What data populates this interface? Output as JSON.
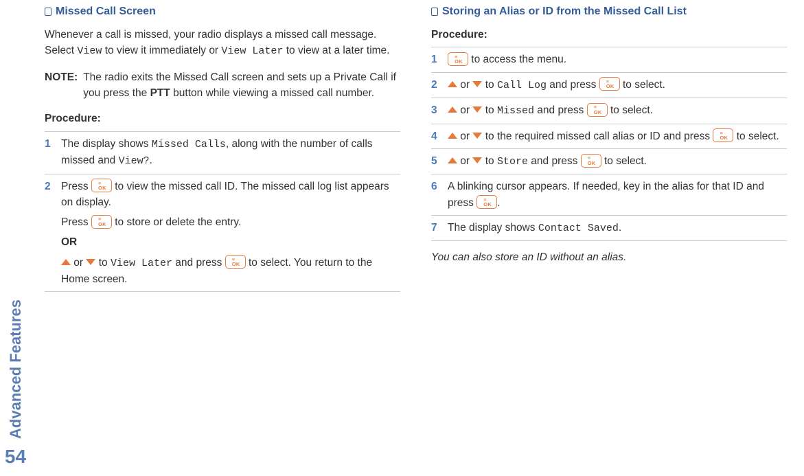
{
  "side": {
    "label": "Advanced Features",
    "page_num": "54"
  },
  "left": {
    "heading": "Missed Call Screen",
    "intro_a": "Whenever a call is missed, your radio displays a missed call message. Select ",
    "intro_view": "View",
    "intro_b": " to view it immediately or ",
    "intro_view_later": "View Later",
    "intro_c": " to view at a later time.",
    "note_label": "NOTE:",
    "note_a": "The radio exits the Missed Call screen and sets up a Private Call if you press the ",
    "note_ptt": "PTT",
    "note_b": " button while viewing a missed call number.",
    "proc": "Procedure:",
    "s1a": "The display shows ",
    "s1_missed": "Missed Calls",
    "s1b": ", along with the number of calls missed and ",
    "s1_viewq": "View?",
    "s1c": ".",
    "s2a": "Press ",
    "s2b": " to view the missed call ID. The missed call log list appears on display.",
    "s2sub_a": "Press ",
    "s2sub_b": " to store or delete the entry.",
    "s2or": "OR",
    "s2alt_a": " or ",
    "s2alt_b": " to ",
    "s2alt_view_later": "View Later",
    "s2alt_c": " and press ",
    "s2alt_d": " to select. You return to the Home screen."
  },
  "right": {
    "heading": "Storing an Alias or ID from the Missed Call List",
    "proc": "Procedure:",
    "s1a": " to access the menu.",
    "s2a": " or ",
    "s2b": " to ",
    "s2_calllog": "Call Log",
    "s2c": " and press ",
    "s2d": " to select.",
    "s3a": " or ",
    "s3b": " to ",
    "s3_missed": "Missed",
    "s3c": " and press ",
    "s3d": " to select.",
    "s4a": " or ",
    "s4b": " to the required missed call alias or ID and press ",
    "s4c": " to select.",
    "s5a": " or ",
    "s5b": " to ",
    "s5_store": "Store",
    "s5c": " and press ",
    "s5d": " to select.",
    "s6a": "A blinking cursor appears. If needed, key in the alias for that ID and press ",
    "s6b": ".",
    "s7a": "The display shows ",
    "s7_saved": "Contact Saved",
    "s7b": ".",
    "footnote": "You can also store an ID without an alias."
  },
  "btn": {
    "top": "≡",
    "bot": "OK"
  },
  "nums": {
    "n1": "1",
    "n2": "2",
    "n3": "3",
    "n4": "4",
    "n5": "5",
    "n6": "6",
    "n7": "7"
  }
}
